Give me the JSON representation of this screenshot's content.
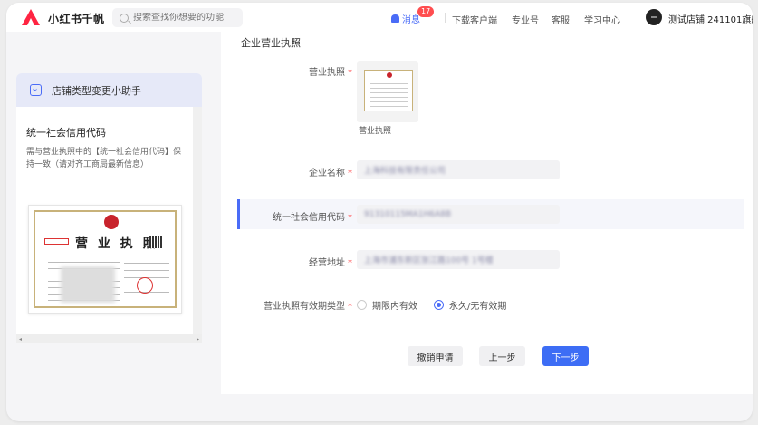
{
  "header": {
    "app_title": "小红书千帆",
    "search_placeholder": "搜索查找你想要的功能",
    "messages_label": "消息",
    "messages_count": "17",
    "links": [
      "下载客户端",
      "专业号",
      "客服",
      "学习中心"
    ],
    "store_name": "测试店铺 241101旗舰"
  },
  "helper": {
    "title": "店铺类型变更小助手",
    "card_title": "统一社会信用代码",
    "card_desc": "需与营业执照中的【统一社会信用代码】保持一致（请对齐工商局最新信息）",
    "license_title": "营 业 执 照",
    "scroll_left": "◂",
    "scroll_right": "▸"
  },
  "form": {
    "section_title": "企业营业执照",
    "fields": {
      "license": {
        "label": "营业执照",
        "caption": "营业执照"
      },
      "company_name": {
        "label": "企业名称",
        "value": "上海科技有限责任公司"
      },
      "credit_code": {
        "label": "统一社会信用代码",
        "value": "91310115MA1H6A8B"
      },
      "address": {
        "label": "经营地址",
        "value": "上海市浦东新区张江路100号 1号楼"
      },
      "validity": {
        "label": "营业执照有效期类型",
        "options": [
          "期限内有效",
          "永久/无有效期"
        ],
        "selected": "永久/无有效期"
      }
    },
    "required_mark": "*",
    "buttons": {
      "cancel": "撤销申请",
      "prev": "上一步",
      "next": "下一步"
    }
  },
  "colors": {
    "primary": "#3d6df5",
    "required": "#ff4d4f",
    "brand": "#ff2442"
  }
}
